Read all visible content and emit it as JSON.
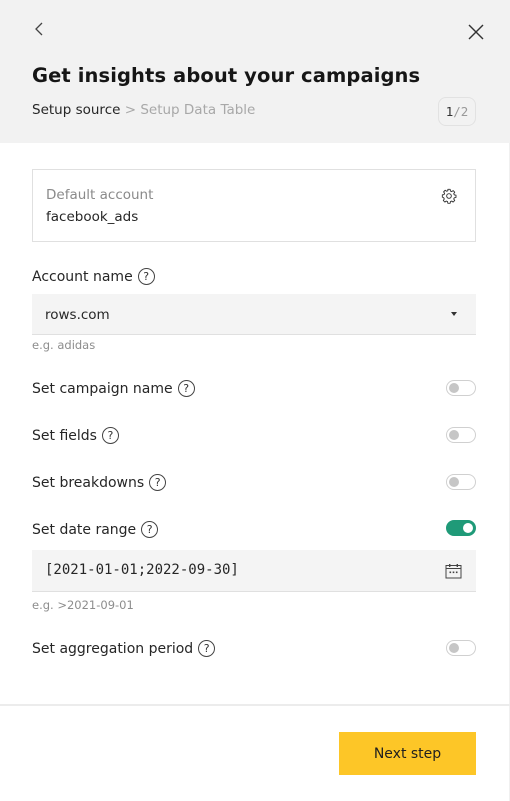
{
  "header": {
    "title": "Get insights about your campaigns",
    "breadcrumb": {
      "current": "Setup source",
      "separator": " > ",
      "next": "Setup Data Table"
    },
    "step": {
      "current": "1",
      "separator": "/",
      "total": "2"
    },
    "back_icon": "chevron-left-icon",
    "close_icon": "close-icon"
  },
  "account_card": {
    "label": "Default account",
    "value": "facebook_ads",
    "settings_icon": "gear-icon"
  },
  "account_name": {
    "label": "Account name",
    "help": "?",
    "value": "rows.com",
    "hint": "e.g. adidas"
  },
  "options": [
    {
      "label": "Set campaign name",
      "help": "?",
      "enabled": false
    },
    {
      "label": "Set fields",
      "help": "?",
      "enabled": false
    },
    {
      "label": "Set breakdowns",
      "help": "?",
      "enabled": false
    },
    {
      "label": "Set date range",
      "help": "?",
      "enabled": true
    },
    {
      "label": "Set aggregation period",
      "help": "?",
      "enabled": false
    }
  ],
  "date_range": {
    "value": "[2021-01-01;2022-09-30]",
    "hint": "e.g. >2021-09-01",
    "icon": "calendar-icon"
  },
  "footer": {
    "next_label": "Next step"
  },
  "colors": {
    "accent": "#fdc627",
    "toggle_on": "#1f9a78",
    "header_bg": "#f2f2f2"
  }
}
